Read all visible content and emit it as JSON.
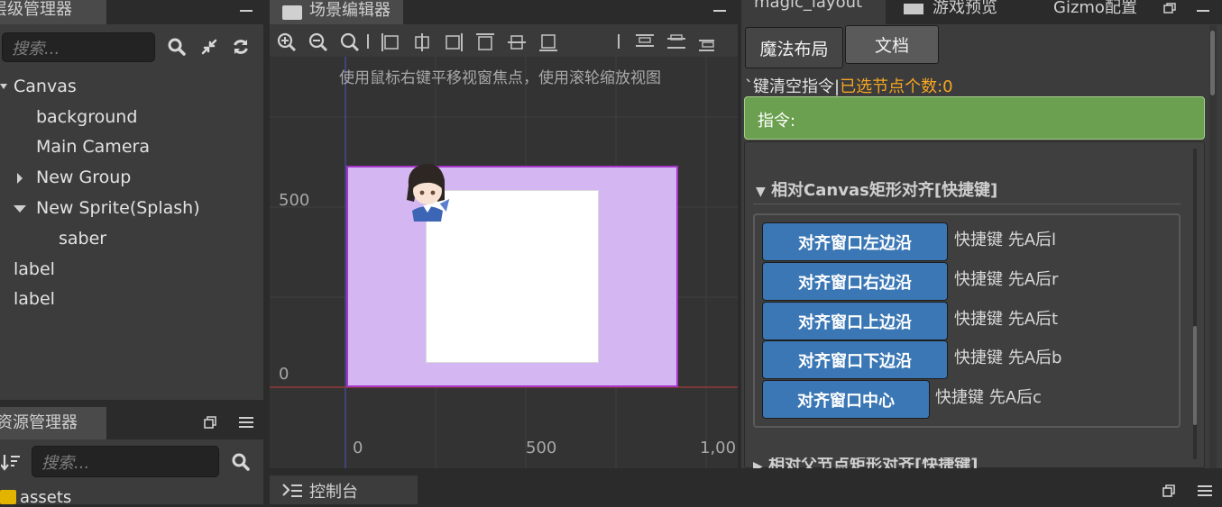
{
  "hierarchy": {
    "title": "层级管理器",
    "search_placeholder": "搜索...",
    "nodes": [
      "Canvas",
      "background",
      "Main Camera",
      "New Group",
      "New Sprite(Splash)",
      "saber",
      "label",
      "label"
    ]
  },
  "assets": {
    "title": "资源管理器",
    "search_placeholder": "搜索...",
    "root": "assets"
  },
  "scene": {
    "title": "场景编辑器",
    "hint": "使用鼠标右键平移视窗焦点，使用滚轮缩放视图",
    "y_labels": [
      "500",
      "0"
    ],
    "x_labels": [
      "0",
      "500",
      "1,00"
    ]
  },
  "console": {
    "title": "控制台"
  },
  "right": {
    "tabs": [
      "magic_layout",
      "游戏预览",
      "Gizmo配置"
    ],
    "sub_tabs": [
      "魔法布局",
      "文档"
    ],
    "status_left": "`键清空指令|",
    "status_right": "已选节点个数:0",
    "command_label": "指令:",
    "section_title": "相对Canvas矩形对齐[快捷键]",
    "buttons": [
      {
        "label": "对齐窗口左边沿",
        "hint": "快捷键 先A后l"
      },
      {
        "label": "对齐窗口右边沿",
        "hint": "快捷键 先A后r"
      },
      {
        "label": "对齐窗口上边沿",
        "hint": "快捷键 先A后t"
      },
      {
        "label": "对齐窗口下边沿",
        "hint": "快捷键 先A后b"
      },
      {
        "label": "对齐窗口中心",
        "hint": "快捷键 先A后c"
      }
    ],
    "next_section": "相对父节点矩形对齐[快捷键]"
  },
  "colors": {
    "accent": "#3a77b4",
    "command_bg": "#6aa04f",
    "status_orange": "#f5a623",
    "canvas_purple": "#d3b6f2",
    "canvas_border": "#a535c7"
  }
}
